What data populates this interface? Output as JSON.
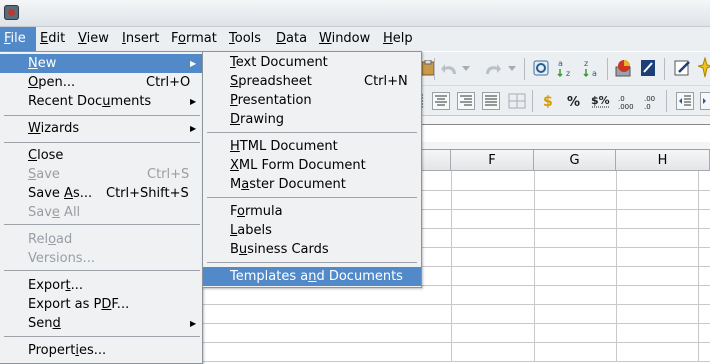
{
  "menubar": {
    "items": [
      {
        "pre": "",
        "u": "F",
        "post": "ile"
      },
      {
        "pre": "",
        "u": "E",
        "post": "dit"
      },
      {
        "pre": "",
        "u": "V",
        "post": "iew"
      },
      {
        "pre": "",
        "u": "I",
        "post": "nsert"
      },
      {
        "pre": "F",
        "u": "o",
        "post": "rmat"
      },
      {
        "pre": "",
        "u": "T",
        "post": "ools"
      },
      {
        "pre": "",
        "u": "D",
        "post": "ata"
      },
      {
        "pre": "",
        "u": "W",
        "post": "indow"
      },
      {
        "pre": "",
        "u": "H",
        "post": "elp"
      }
    ]
  },
  "file_menu": {
    "items": [
      {
        "pre": "",
        "u": "N",
        "post": "ew",
        "shortcut": "",
        "submenu": true
      },
      {
        "pre": "",
        "u": "O",
        "post": "pen...",
        "shortcut": "Ctrl+O"
      },
      {
        "pre": "Recent Doc",
        "u": "u",
        "post": "ments",
        "shortcut": "",
        "submenu": true
      },
      {
        "pre": "",
        "u": "W",
        "post": "izards",
        "shortcut": "",
        "submenu": true
      },
      {
        "pre": "",
        "u": "C",
        "post": "lose",
        "shortcut": ""
      },
      {
        "pre": "",
        "u": "S",
        "post": "ave",
        "shortcut": "Ctrl+S"
      },
      {
        "pre": "Save ",
        "u": "A",
        "post": "s...",
        "shortcut": "Ctrl+Shift+S"
      },
      {
        "pre": "Sav",
        "u": "e",
        "post": " All",
        "shortcut": ""
      },
      {
        "pre": "Rel",
        "u": "o",
        "post": "ad",
        "shortcut": ""
      },
      {
        "pre": "Versions...",
        "u": "",
        "post": "",
        "shortcut": ""
      },
      {
        "pre": "Expor",
        "u": "t",
        "post": "...",
        "shortcut": ""
      },
      {
        "pre": "Export as P",
        "u": "D",
        "post": "F...",
        "shortcut": ""
      },
      {
        "pre": "Sen",
        "u": "d",
        "post": "",
        "shortcut": "",
        "submenu": true
      },
      {
        "pre": "Propert",
        "u": "i",
        "post": "es...",
        "shortcut": ""
      }
    ]
  },
  "new_menu": {
    "items": [
      {
        "pre": "",
        "u": "T",
        "post": "ext Document",
        "shortcut": ""
      },
      {
        "pre": "",
        "u": "S",
        "post": "preadsheet",
        "shortcut": "Ctrl+N"
      },
      {
        "pre": "",
        "u": "P",
        "post": "resentation",
        "shortcut": ""
      },
      {
        "pre": "",
        "u": "D",
        "post": "rawing",
        "shortcut": ""
      },
      {
        "pre": "",
        "u": "H",
        "post": "TML Document",
        "shortcut": ""
      },
      {
        "pre": "",
        "u": "X",
        "post": "ML Form Document",
        "shortcut": ""
      },
      {
        "pre": "M",
        "u": "a",
        "post": "ster Document",
        "shortcut": ""
      },
      {
        "pre": "F",
        "u": "o",
        "post": "rmula",
        "shortcut": ""
      },
      {
        "pre": "",
        "u": "L",
        "post": "abels",
        "shortcut": ""
      },
      {
        "pre": "B",
        "u": "u",
        "post": "siness Cards",
        "shortcut": ""
      },
      {
        "pre": "Templates a",
        "u": "n",
        "post": "d Documents",
        "shortcut": ""
      }
    ]
  },
  "sheet": {
    "columns": [
      "F",
      "G",
      "H"
    ]
  },
  "colors": {
    "highlight": "#5289c8",
    "menu_bg": "#eff1f3",
    "disabled_text": "#9a9ea3"
  }
}
